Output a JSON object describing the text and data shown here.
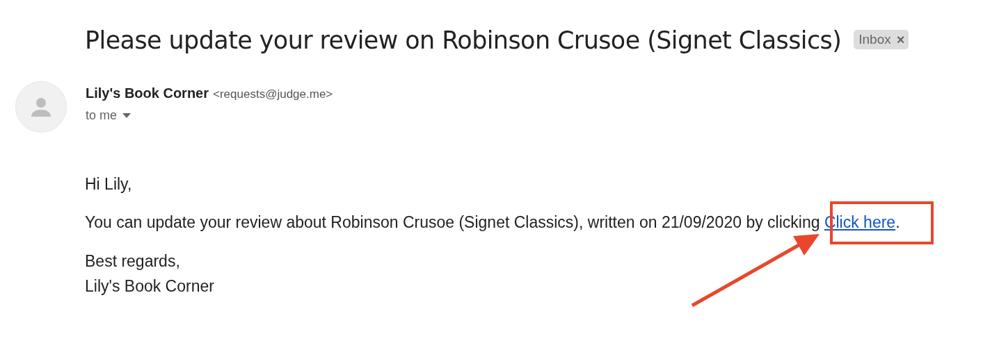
{
  "subject": "Please update your review on Robinson Crusoe (Signet Classics)",
  "label": {
    "text": "Inbox",
    "close": "×"
  },
  "sender": {
    "name": "Lily's Book Corner",
    "email": "<requests@judge.me>",
    "recipient": "to me"
  },
  "body": {
    "greeting": "Hi Lily,",
    "paragraph": {
      "text": "You can update your review about Robinson Crusoe (Signet Classics), written on 21/09/2020 by clicking ",
      "link": "Click here",
      "after": "."
    },
    "signoff": [
      "Best regards,",
      "Lily's Book Corner"
    ]
  }
}
